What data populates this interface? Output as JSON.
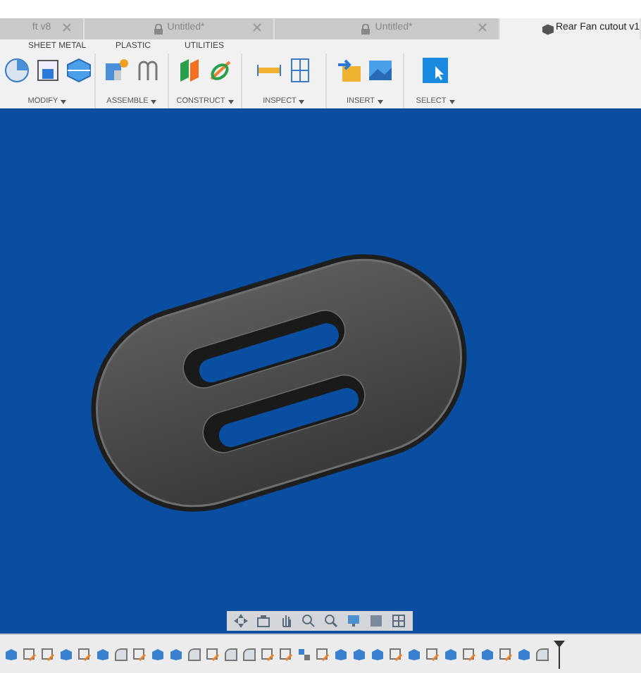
{
  "tabs": [
    {
      "label": "ft v8",
      "selected": false,
      "locked": false
    },
    {
      "label": "Untitled*",
      "selected": false,
      "locked": true
    },
    {
      "label": "Untitled*",
      "selected": false,
      "locked": true
    },
    {
      "label": "Rear Fan cutout v1",
      "selected": true,
      "locked": false
    }
  ],
  "ribbon_tabs": [
    "SHEET METAL",
    "PLASTIC",
    "UTILITIES"
  ],
  "toolbar_groups": [
    {
      "label": "MODIFY",
      "kind": "modify"
    },
    {
      "label": "ASSEMBLE",
      "kind": "assemble"
    },
    {
      "label": "CONSTRUCT",
      "kind": "construct"
    },
    {
      "label": "INSPECT",
      "kind": "inspect"
    },
    {
      "label": "INSERT",
      "kind": "insert"
    },
    {
      "label": "SELECT",
      "kind": "select"
    }
  ]
}
